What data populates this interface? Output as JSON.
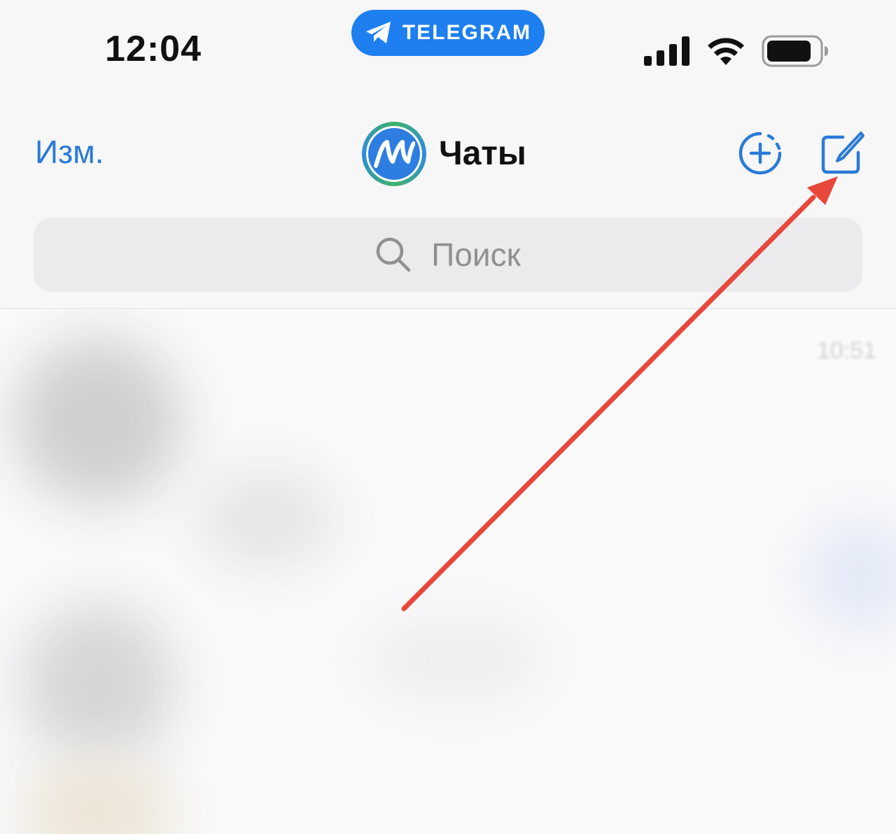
{
  "status_bar": {
    "time": "12:04",
    "app_pill_label": "TELEGRAM",
    "icons": [
      "signal-icon",
      "wifi-icon",
      "battery-icon"
    ]
  },
  "nav": {
    "edit_label": "Изм.",
    "title": "Чаты",
    "avatar_icon": "user-avatar",
    "story_icon": "add-story-icon",
    "compose_icon": "compose-icon"
  },
  "search": {
    "placeholder": "Поиск",
    "icon": "search-icon"
  },
  "chat_list": {
    "first_item_time": "10:51"
  },
  "annotation": {
    "type": "arrow",
    "color": "#e8473b",
    "target": "compose-button"
  },
  "colors": {
    "accent": "#2a7ad8",
    "telegram_blue": "#1d7ff0",
    "background": "#f7f7f8"
  }
}
